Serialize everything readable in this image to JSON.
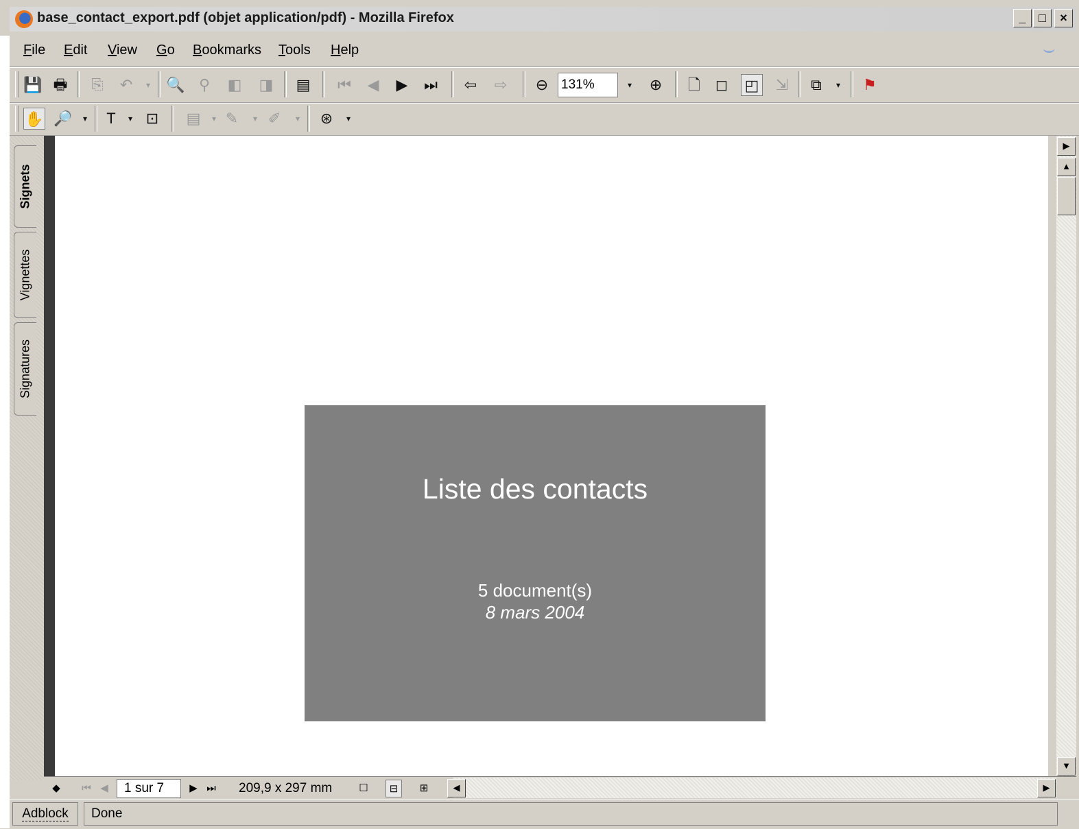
{
  "window": {
    "title": "base_contact_export.pdf (objet application/pdf) - Mozilla Firefox",
    "controls": [
      "_",
      "□",
      "×"
    ]
  },
  "menubar": {
    "items": [
      {
        "label": "File",
        "accel": "F",
        "rest": "ile"
      },
      {
        "label": "Edit",
        "accel": "E",
        "rest": "dit"
      },
      {
        "label": "View",
        "accel": "V",
        "rest": "iew"
      },
      {
        "label": "Go",
        "accel": "G",
        "rest": "o"
      },
      {
        "label": "Bookmarks",
        "accel": "B",
        "rest": "ookmarks"
      },
      {
        "label": "Tools",
        "accel": "T",
        "rest": "ools"
      },
      {
        "label": "Help",
        "accel": "H",
        "rest": "elp"
      }
    ]
  },
  "toolbar": {
    "zoom_value": "131%"
  },
  "side_tabs": [
    "Signets",
    "Vignettes",
    "Signatures"
  ],
  "document": {
    "title": "Liste des contacts",
    "count": "5 document(s)",
    "date": "8 mars 2004",
    "cover_color": "#808080"
  },
  "navigation": {
    "page_indicator": "1 sur 7",
    "page_size": "209,9 x 297 mm"
  },
  "statusbar": {
    "adblock": "Adblock",
    "status": "Done"
  }
}
